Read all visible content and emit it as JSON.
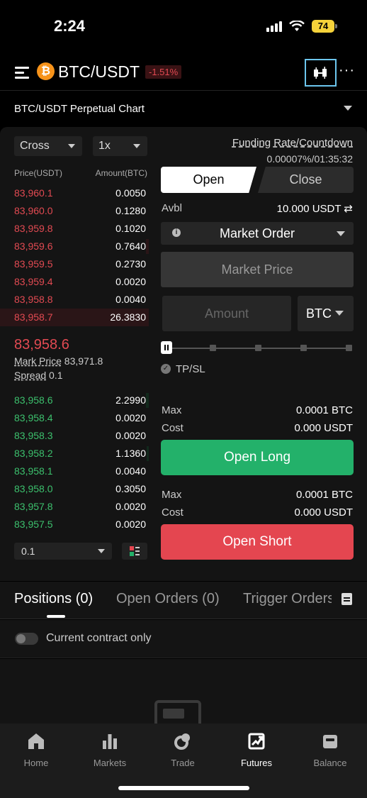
{
  "status_bar": {
    "time": "2:24",
    "battery": "74"
  },
  "header": {
    "coin_symbol": "₿",
    "pair": "BTC/USDT",
    "change": "-1.51%",
    "more": "···"
  },
  "chart_row": {
    "label": "BTC/USDT Perpetual Chart"
  },
  "controls": {
    "margin_mode": "Cross",
    "leverage": "1x"
  },
  "funding": {
    "label": "Funding Rate/Countdown",
    "value": "0.00007%/01:35:32"
  },
  "order_book": {
    "price_header": "Price(USDT)",
    "amount_header": "Amount(BTC)",
    "asks": [
      {
        "price": "83,960.1",
        "amount": "0.0050"
      },
      {
        "price": "83,960.0",
        "amount": "0.1280"
      },
      {
        "price": "83,959.8",
        "amount": "0.1020"
      },
      {
        "price": "83,959.6",
        "amount": "0.7640"
      },
      {
        "price": "83,959.5",
        "amount": "0.2730"
      },
      {
        "price": "83,959.4",
        "amount": "0.0020"
      },
      {
        "price": "83,958.8",
        "amount": "0.0040"
      },
      {
        "price": "83,958.7",
        "amount": "26.3830"
      }
    ],
    "last_price": "83,958.6",
    "mark_price_label": "Mark Price",
    "mark_price": "83,971.8",
    "spread_label": "Spread",
    "spread": "0.1",
    "bids": [
      {
        "price": "83,958.6",
        "amount": "2.2990"
      },
      {
        "price": "83,958.4",
        "amount": "0.0020"
      },
      {
        "price": "83,958.3",
        "amount": "0.0020"
      },
      {
        "price": "83,958.2",
        "amount": "1.1360"
      },
      {
        "price": "83,958.1",
        "amount": "0.0040"
      },
      {
        "price": "83,958.0",
        "amount": "0.3050"
      },
      {
        "price": "83,957.8",
        "amount": "0.0020"
      },
      {
        "price": "83,957.5",
        "amount": "0.0020"
      }
    ],
    "precision": "0.1"
  },
  "trade_form": {
    "tab_open": "Open",
    "tab_close": "Close",
    "avbl_label": "Avbl",
    "avbl_value": "10.000 USDT ⇄",
    "order_type": "Market Order",
    "market_price": "Market Price",
    "amount_placeholder": "Amount",
    "unit": "BTC",
    "tpsl": "TP/SL",
    "long": {
      "max_label": "Max",
      "max_value": "0.0001 BTC",
      "cost_label": "Cost",
      "cost_value": "0.000 USDT",
      "button": "Open Long"
    },
    "short": {
      "max_label": "Max",
      "max_value": "0.0001 BTC",
      "cost_label": "Cost",
      "cost_value": "0.000 USDT",
      "button": "Open Short"
    }
  },
  "bottom_tabs": {
    "positions": "Positions (0)",
    "open_orders": "Open Orders (0)",
    "trigger_orders": "Trigger Orders"
  },
  "contract_filter": {
    "label": "Current contract only"
  },
  "nav": {
    "home": "Home",
    "markets": "Markets",
    "trade": "Trade",
    "futures": "Futures",
    "balance": "Balance"
  },
  "colors": {
    "buy": "#23b16a",
    "sell": "#e44650",
    "accent_border": "#6cc6ee",
    "bitcoin": "#f7931a"
  }
}
